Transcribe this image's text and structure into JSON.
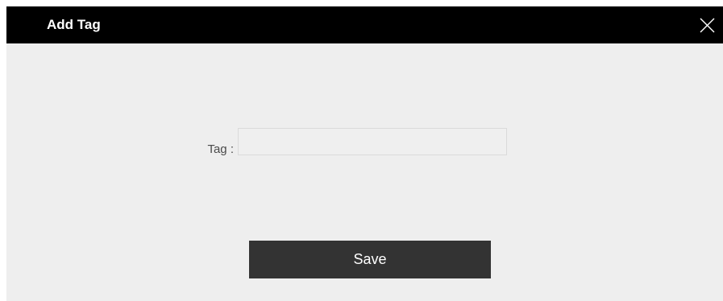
{
  "dialog": {
    "title": "Add Tag",
    "close_icon": "close-icon"
  },
  "form": {
    "tag_label": "Tag :",
    "tag_value": "",
    "tag_placeholder": ""
  },
  "actions": {
    "save_label": "Save"
  },
  "colors": {
    "titlebar": "#000000",
    "background": "#eeeeee",
    "button": "#333333"
  }
}
